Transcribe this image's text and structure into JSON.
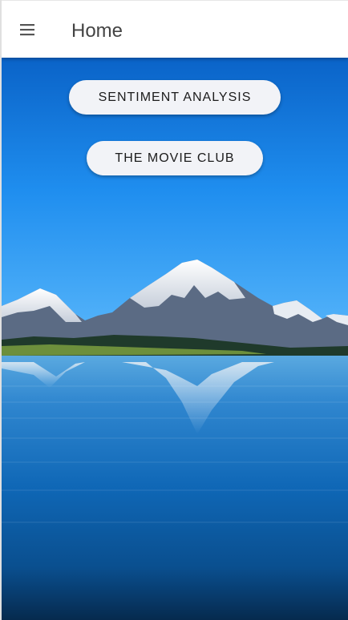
{
  "header": {
    "title": "Home",
    "menu_icon": "hamburger-menu-icon"
  },
  "buttons": {
    "sentiment_label": "SENTIMENT ANALYSIS",
    "movie_club_label": "THE MOVIE CLUB"
  },
  "background": {
    "description_icon": "mountain-lake-image"
  },
  "colors": {
    "toolbar_bg": "#ffffff",
    "button_bg": "#f2f3f7",
    "sky_top": "#0a63c8",
    "water": "#0b5fae"
  }
}
